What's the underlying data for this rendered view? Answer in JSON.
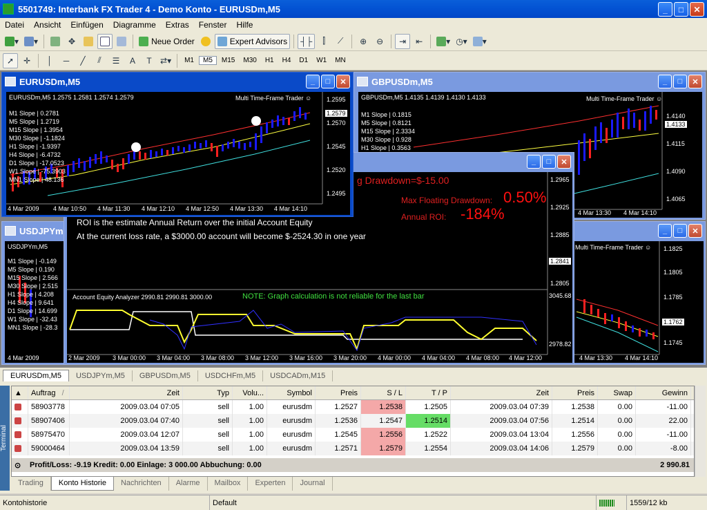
{
  "app": {
    "title": "5501749: Interbank FX Trader 4 - Demo Konto - EURUSDm,M5",
    "controls": [
      "_",
      "□",
      "✕"
    ]
  },
  "menu": [
    "Datei",
    "Ansicht",
    "Einfügen",
    "Diagramme",
    "Extras",
    "Fenster",
    "Hilfe"
  ],
  "toolbar": {
    "new_order": "Neue Order",
    "expert_advisors": "Expert Advisors",
    "timeframes": [
      "M1",
      "M5",
      "M15",
      "M30",
      "H1",
      "H4",
      "D1",
      "W1",
      "MN"
    ],
    "active_timeframe": "M5"
  },
  "windows": {
    "eurusd": {
      "title": "EURUSDm,M5",
      "header": "EURUSDm,M5  1.2575 1.2581 1.2574 1.2579",
      "indicator": "Multi Time-Frame Trader ☺",
      "slopes": [
        "M1  Slope | 0.2781",
        "M5  Slope | 1.2719",
        "M15 Slope | 1.3954",
        "M30 Slope | -1.1824",
        "H1  Slope | -1.9397",
        "H4  Slope | -6.4732",
        "D1  Slope | -17.0523",
        "W1  Slope | -75.3903",
        "MN1 Slope | 48.136"
      ],
      "prices": [
        "1.2595",
        "1.2579",
        "1.2570",
        "1.2545",
        "1.2520",
        "1.2495"
      ],
      "times": [
        "4 Mar 2009",
        "4 Mar 10:50",
        "4 Mar 11:30",
        "4 Mar 12:10",
        "4 Mar 12:50",
        "4 Mar 13:30",
        "4 Mar 14:10"
      ]
    },
    "gbpusd": {
      "title": "GBPUSDm,M5",
      "header": "GBPUSDm,M5  1.4135 1.4139 1.4130 1.4133",
      "indicator": "Multi Time-Frame Trader ☺",
      "slopes": [
        "M1  Slope | 0.1815",
        "M5  Slope | 0.8121",
        "M15 Slope | 2.3334",
        "M30 Slope | 0.928",
        "H1  Slope | 0.3563"
      ],
      "prices": [
        "1.4140",
        "1.4133",
        "1.4115",
        "1.4090",
        "1.4065"
      ],
      "times": [
        "4 Mar 13:30",
        "4 Mar 14:10"
      ]
    },
    "usdjpy": {
      "title": "USDJPYm",
      "header": "USDJPYm,M5",
      "slopes": [
        "M1  Slope | -0.149",
        "M5  Slope | 0.190",
        "M15 Slope | 2.566",
        "M30 Slope | 2.515",
        "H1  Slope | 4.208",
        "H4  Slope | 9.641",
        "D1  Slope | 14.699",
        "W1  Slope | -32.43",
        "MN1 Slope | -28.3"
      ],
      "times": [
        "4 Mar 2009",
        "4 Mar 10"
      ]
    },
    "usdchf": {
      "indicator": "Multi Time-Frame Trader ☺",
      "prices": [
        "1.1825",
        "1.1805",
        "1.1785",
        "1.1762",
        "1.1745"
      ],
      "times": [
        "4 Mar 13:30",
        "4 Mar 14:10"
      ]
    },
    "analyzer": {
      "drawdown_text": "g Drawdown=$-15.00",
      "max_float_label": "Max Floating Drawdown:",
      "max_float_value": "0.50%",
      "roi_label": "Annual ROI:",
      "roi_value": "-184%",
      "line1": "ROI is the estimate Annual Return over the initial Account Equity",
      "line2": "At the current loss rate,  a $3000.00 account will become $-2524.30 in one year",
      "equity_header": "Account Equity Analyzer 2990.81 2990.81 3000.00",
      "note": "NOTE: Graph calculation is not reliable for the last bar",
      "upper_prices": [
        "1.2965",
        "1.2925",
        "1.2885",
        "1.2841",
        "1.2805"
      ],
      "equity_prices": [
        "3045.68",
        "2978.82"
      ],
      "times": [
        "2 Mar 2009",
        "3 Mar 00:00",
        "3 Mar 04:00",
        "3 Mar 08:00",
        "3 Mar 12:00",
        "3 Mar 16:00",
        "3 Mar 20:00",
        "4 Mar 00:00",
        "4 Mar 04:00",
        "4 Mar 08:00",
        "4 Mar 12:00"
      ]
    }
  },
  "chart_tabs": [
    "EURUSDm,M5",
    "USDJPYm,M5",
    "GBPUSDm,M5",
    "USDCHFm,M5",
    "USDCADm,M15"
  ],
  "chart_tab_active": 0,
  "terminal": {
    "side_label": "Terminal",
    "columns": [
      "",
      "Auftrag",
      "Zeit",
      "Typ",
      "Volu...",
      "Symbol",
      "Preis",
      "S / L",
      "T / P",
      "Zeit",
      "Preis",
      "Swap",
      "Gewinn"
    ],
    "sort_marker": "/",
    "rows": [
      {
        "auftrag": "58903778",
        "zeit": "2009.03.04 07:05",
        "typ": "sell",
        "vol": "1.00",
        "symbol": "eurusdm",
        "preis": "1.2527",
        "sl": "1.2538",
        "tp": "1.2505",
        "zeit2": "2009.03.04 07:39",
        "preis2": "1.2538",
        "swap": "0.00",
        "gewinn": "-11.00",
        "sl_hit": true,
        "tp_hit": false
      },
      {
        "auftrag": "58907406",
        "zeit": "2009.03.04 07:40",
        "typ": "sell",
        "vol": "1.00",
        "symbol": "eurusdm",
        "preis": "1.2536",
        "sl": "1.2547",
        "tp": "1.2514",
        "zeit2": "2009.03.04 07:56",
        "preis2": "1.2514",
        "swap": "0.00",
        "gewinn": "22.00",
        "sl_hit": false,
        "tp_hit": true
      },
      {
        "auftrag": "58975470",
        "zeit": "2009.03.04 12:07",
        "typ": "sell",
        "vol": "1.00",
        "symbol": "eurusdm",
        "preis": "1.2545",
        "sl": "1.2556",
        "tp": "1.2522",
        "zeit2": "2009.03.04 13:04",
        "preis2": "1.2556",
        "swap": "0.00",
        "gewinn": "-11.00",
        "sl_hit": true,
        "tp_hit": false
      },
      {
        "auftrag": "59000464",
        "zeit": "2009.03.04 13:59",
        "typ": "sell",
        "vol": "1.00",
        "symbol": "eurusdm",
        "preis": "1.2571",
        "sl": "1.2579",
        "tp": "1.2554",
        "zeit2": "2009.03.04 14:06",
        "preis2": "1.2579",
        "swap": "0.00",
        "gewinn": "-8.00",
        "sl_hit": true,
        "tp_hit": false
      }
    ],
    "total_label": "Profit/Loss: -9.19  Kredit: 0.00  Einlage: 3 000.00  Abbuchung: 0.00",
    "total_value": "2 990.81",
    "tabs": [
      "Trading",
      "Konto Historie",
      "Nachrichten",
      "Alarme",
      "Mailbox",
      "Experten",
      "Journal"
    ],
    "active_tab": 1
  },
  "status": {
    "left": "Kontohistorie",
    "profile": "Default",
    "traffic": "1559/12 kb"
  },
  "colors": {
    "titlebar": "#0454d4",
    "chart_bg": "#000000",
    "bull_candle": "#1a1aff",
    "bear_candle": "#ff2020",
    "upper_band": "#ff3030",
    "mid_band": "#ffff40",
    "lower_band": "#40e0e0",
    "sl_red": "#f4a8a8",
    "tp_green": "#66dd66"
  }
}
